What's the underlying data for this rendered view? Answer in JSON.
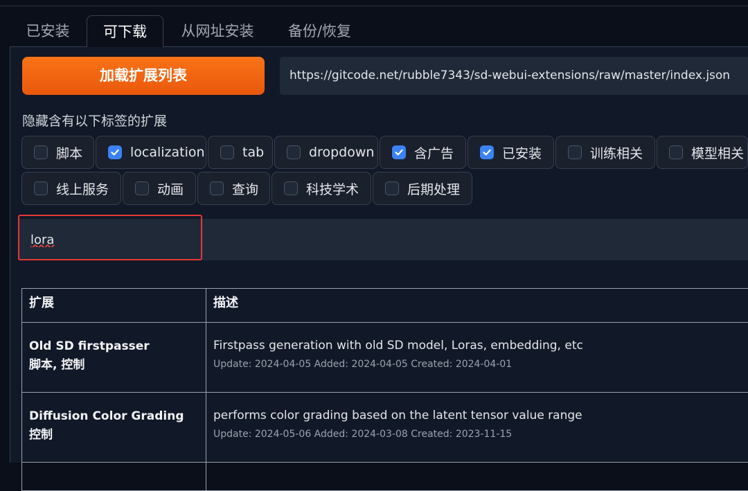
{
  "tabs": [
    {
      "label": "已安装"
    },
    {
      "label": "可下载",
      "active": true
    },
    {
      "label": "从网址安装"
    },
    {
      "label": "备份/恢复"
    }
  ],
  "load_button": {
    "label": "加载扩展列表"
  },
  "url_input": {
    "value": "https://gitcode.net/rubble7343/sd-webui-extensions/raw/master/index.json"
  },
  "hide_filter": {
    "label": "隐藏含有以下标签的扩展",
    "options": [
      {
        "label": "脚本",
        "checked": false
      },
      {
        "label": "localization",
        "checked": true
      },
      {
        "label": "tab",
        "checked": false
      },
      {
        "label": "dropdown",
        "checked": false
      },
      {
        "label": "含广告",
        "checked": true
      },
      {
        "label": "已安装",
        "checked": true
      },
      {
        "label": "训练相关",
        "checked": false
      },
      {
        "label": "模型相关",
        "checked": false
      },
      {
        "label": "线上服务",
        "checked": false
      },
      {
        "label": "动画",
        "checked": false
      },
      {
        "label": "查询",
        "checked": false
      },
      {
        "label": "科技学术",
        "checked": false
      },
      {
        "label": "后期处理",
        "checked": false
      }
    ]
  },
  "search": {
    "value": "lora"
  },
  "table": {
    "headers": [
      "扩展",
      "描述"
    ],
    "rows": [
      {
        "name": "Old SD firstpasser",
        "tags": "脚本, 控制",
        "description": "Firstpass generation with old SD model, Loras, embedding, etc",
        "meta": "Update: 2024-04-05 Added: 2024-04-05 Created: 2024-04-01"
      },
      {
        "name": "Diffusion Color Grading",
        "tags": "控制",
        "description": "performs color grading based on the latent tensor value range",
        "meta": "Update: 2024-05-06 Added: 2024-03-08 Created: 2023-11-15"
      }
    ]
  },
  "colors": {
    "accent": "#f97316",
    "checkbox": "#3b82f6",
    "highlight": "#e53935",
    "background": "#0b0f19"
  }
}
